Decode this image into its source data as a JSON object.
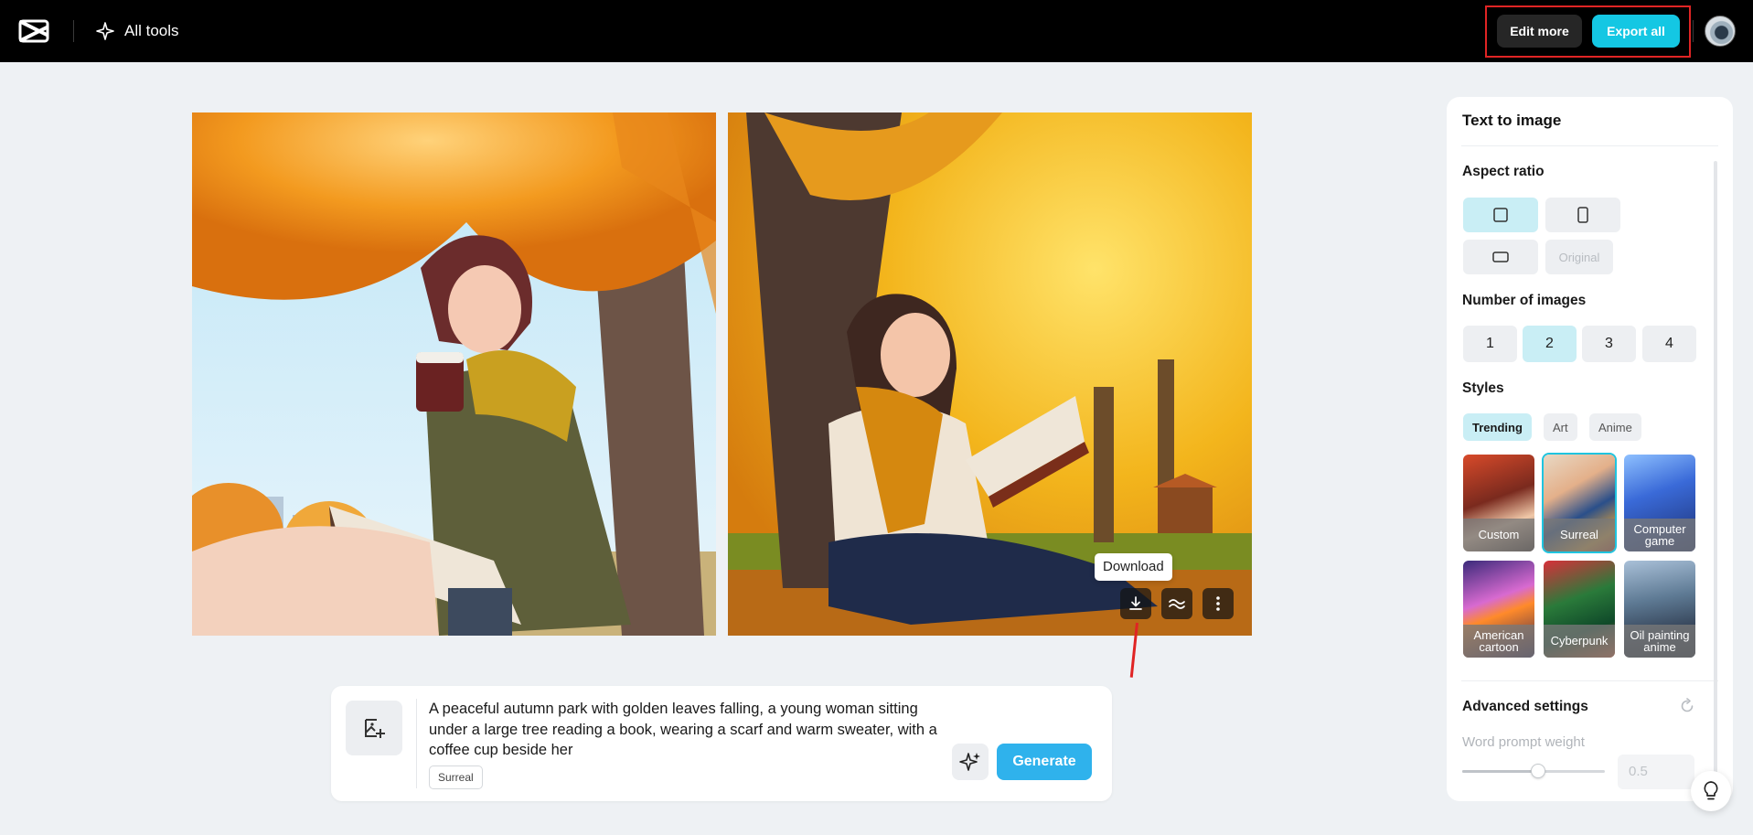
{
  "header": {
    "all_tools_label": "All tools",
    "edit_more_label": "Edit more",
    "export_all_label": "Export all"
  },
  "images": [
    {
      "description_icon": "autumn-reading-coffee-image"
    },
    {
      "description_icon": "autumn-reading-book-image"
    }
  ],
  "image_tools": {
    "tooltip": "Download",
    "icons": [
      "download-icon",
      "upscale-icon",
      "more-icon"
    ]
  },
  "prompt": {
    "text": "A peaceful autumn park with golden leaves falling, a young woman sitting under a large tree reading a book, wearing a scarf and warm sweater, with a coffee cup beside her",
    "style_tag": "Surreal",
    "generate_label": "Generate"
  },
  "panel": {
    "title": "Text to image",
    "aspect_ratio_label": "Aspect ratio",
    "aspect_ratios": [
      {
        "icon": "square-icon",
        "selected": true
      },
      {
        "icon": "portrait-icon",
        "selected": false
      },
      {
        "icon": "landscape-icon",
        "selected": false
      },
      {
        "label": "Original",
        "selected": false
      }
    ],
    "num_images_label": "Number of images",
    "num_images": [
      "1",
      "2",
      "3",
      "4"
    ],
    "num_images_selected": "2",
    "styles_label": "Styles",
    "style_tabs": [
      "Trending",
      "Art",
      "Anime"
    ],
    "style_tab_selected": "Trending",
    "style_cards": [
      {
        "label": "Custom",
        "selected": false
      },
      {
        "label": "Surreal",
        "selected": true
      },
      {
        "label": "Computer game",
        "selected": false
      },
      {
        "label": "American cartoon",
        "selected": false
      },
      {
        "label": "Cyberpunk",
        "selected": false
      },
      {
        "label": "Oil painting anime",
        "selected": false
      }
    ],
    "advanced_label": "Advanced settings",
    "word_prompt_weight_label": "Word prompt weight",
    "word_prompt_weight_value": "0.5",
    "word_prompt_weight_fraction": 0.5
  },
  "colors": {
    "accent": "#14c7e3",
    "generate": "#2fb2ec",
    "selected_bg": "#c9eef5",
    "highlight": "#e02424"
  }
}
